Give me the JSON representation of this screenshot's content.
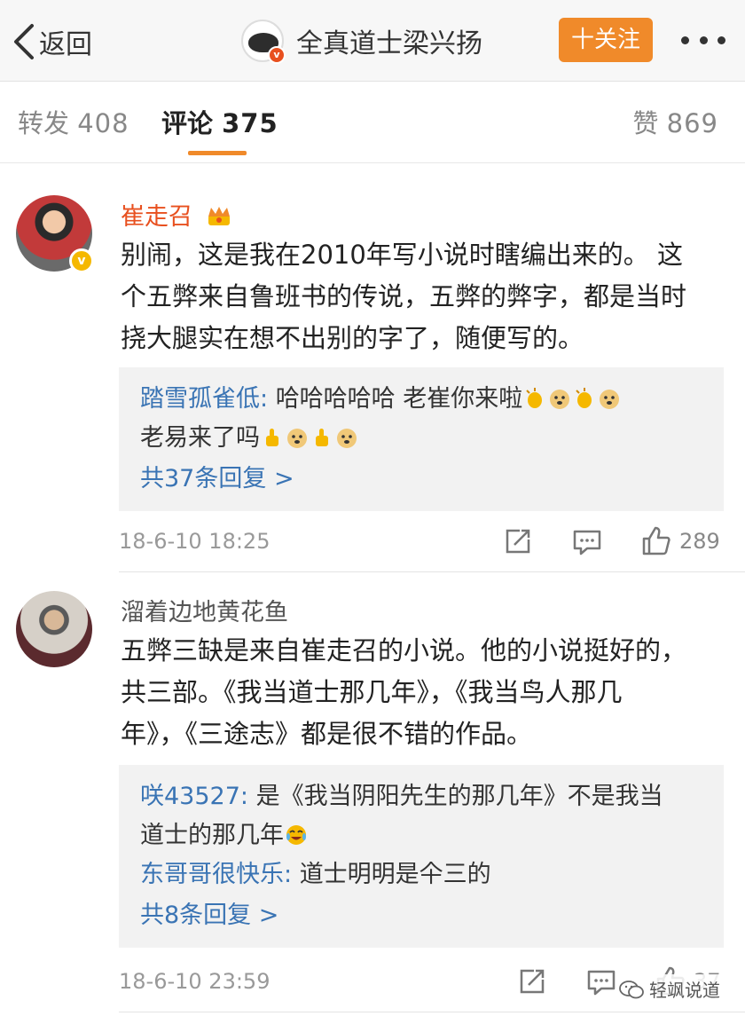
{
  "nav": {
    "back_label": "返回",
    "title": "全真道士梁兴扬",
    "follow_label": "十关注"
  },
  "tabs": {
    "repost": {
      "label": "转发",
      "count": "408"
    },
    "comments": {
      "label": "评论",
      "count": "375"
    },
    "likes": {
      "label": "赞",
      "count": "869"
    }
  },
  "comments": [
    {
      "author": "崔走召",
      "text_lines": [
        "别闹，这是我在2010年写小说时瞎编出来的。 这",
        "个五弊来自鲁班书的传说，五弊的弊字，都是当时",
        "挠大腿实在想不出别的字了，随便写的。"
      ],
      "replies": [
        {
          "user": "踏雪孤雀低",
          "text": "哈哈哈哈哈 老崔你来啦",
          "text2": "老易来了吗"
        }
      ],
      "more_replies": "共37条回复 >",
      "time": "18-6-10 18:25",
      "likes": "289"
    },
    {
      "author": "溜着边地黄花鱼",
      "text_lines": [
        "五弊三缺是来自崔走召的小说。他的小说挺好的，",
        "共三部。《我当道士那几年》，《我当鸟人那几",
        "年》，《三途志》都是很不错的作品。"
      ],
      "replies": [
        {
          "user": "咲43527",
          "text": "是《我当阴阳先生的那几年》不是我当",
          "text2": "道士的那几年"
        },
        {
          "user": "东哥哥很快乐",
          "text": "道士明明是仐三的"
        }
      ],
      "more_replies": "共8条回复 >",
      "time": "18-6-10 23:59",
      "likes": "37"
    }
  ],
  "watermark": "轻飒说道",
  "colors": {
    "accent": "#f08a2a",
    "link": "#3a74b4",
    "vip_name": "#e8501f"
  }
}
